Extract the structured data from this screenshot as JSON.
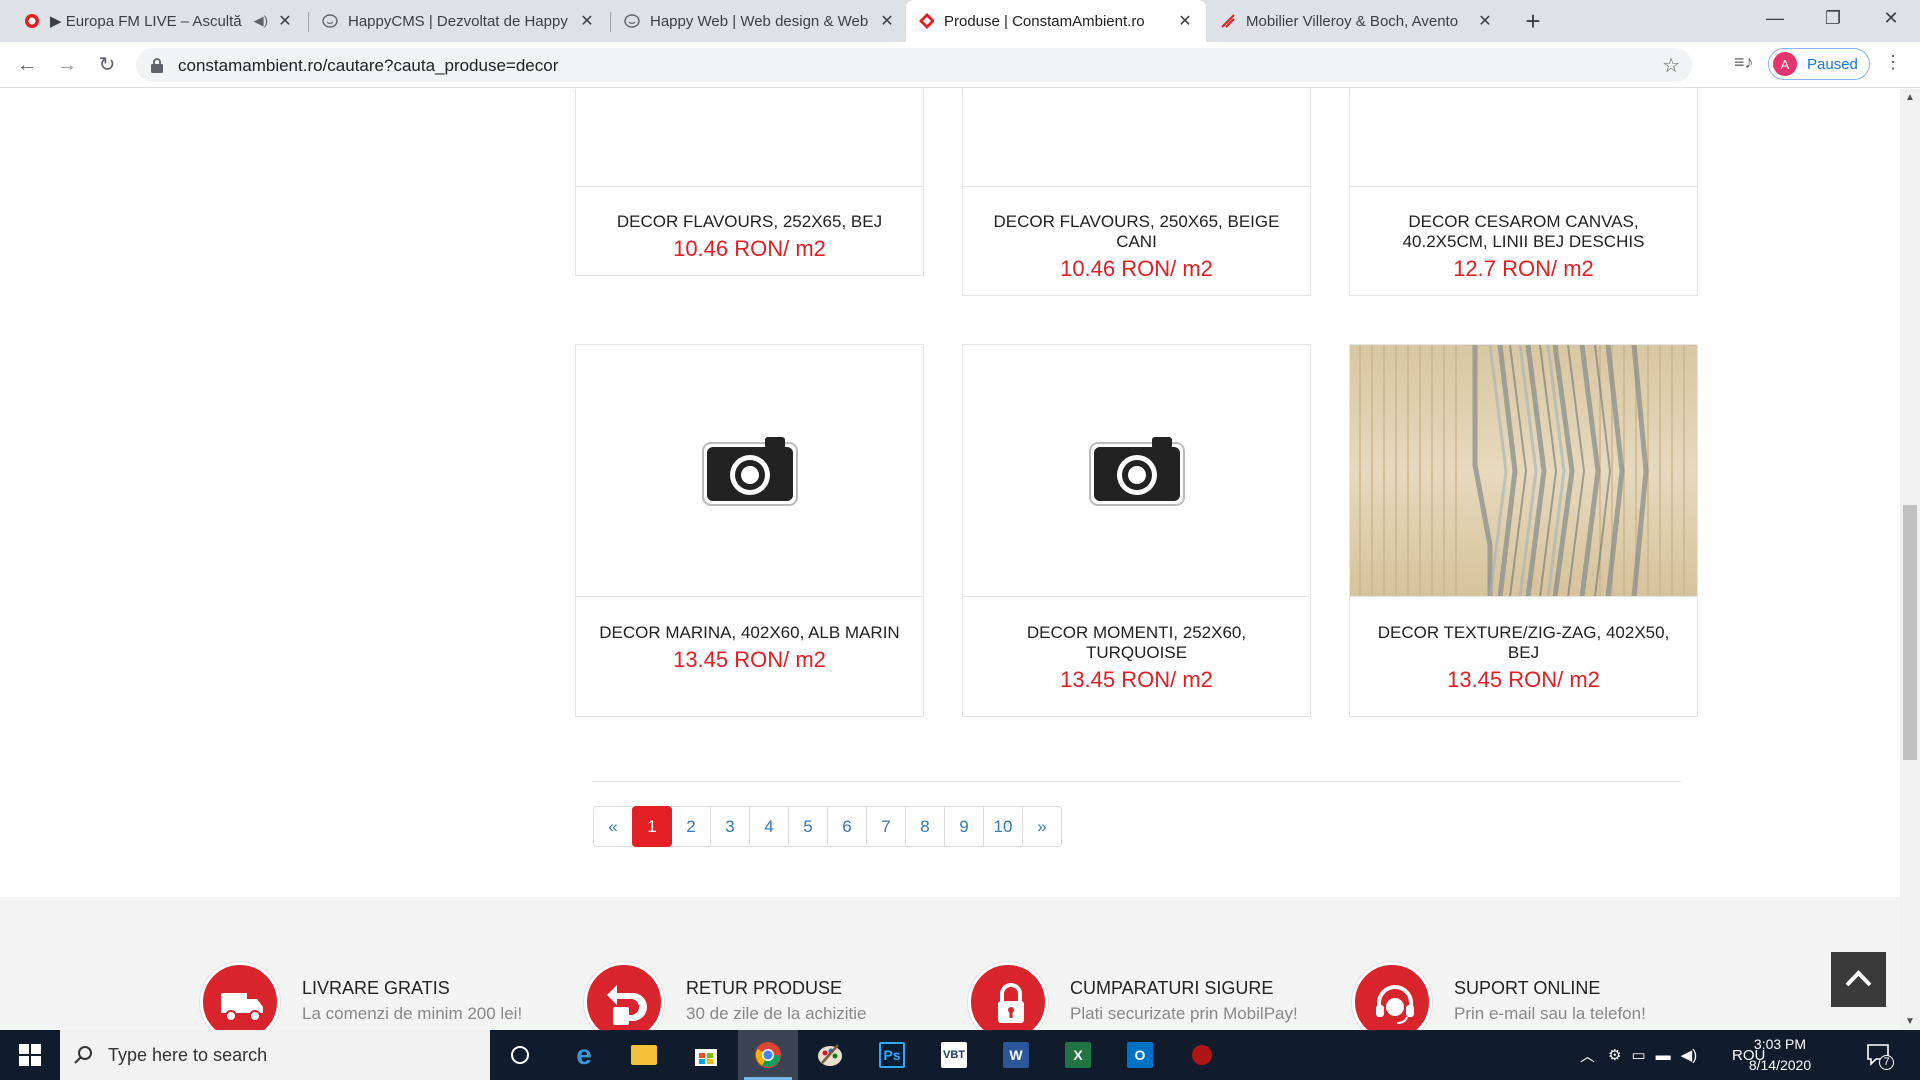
{
  "browser": {
    "tabs": [
      {
        "title": "▶ Europa FM LIVE – Ascultă",
        "favicon": "europafm-icon",
        "audio": true
      },
      {
        "title": "HappyCMS | Dezvoltat de Happy",
        "favicon": "happy-icon"
      },
      {
        "title": "Happy Web | Web design & Web",
        "favicon": "happy-icon"
      },
      {
        "title": "Produse | ConstamAmbient.ro",
        "favicon": "constam-icon",
        "active": true
      },
      {
        "title": "Mobilier Villeroy & Boch, Avento",
        "favicon": "villeroy-icon"
      }
    ],
    "url": "constamambient.ro/cautare?cauta_produse=decor",
    "profile_initial": "A",
    "profile_status": "Paused"
  },
  "products": [
    {
      "name": "DECOR FLAVOURS, 252X65, BEJ",
      "price": "10.46 RON/ m2",
      "image": "camera-placeholder"
    },
    {
      "name": "DECOR FLAVOURS, 250X65, BEIGE CANI",
      "price": "10.46 RON/ m2",
      "image": "camera-placeholder"
    },
    {
      "name": "DECOR CESAROM CANVAS, 40.2X5CM, LINII BEJ DESCHIS",
      "price": "12.7 RON/ m2",
      "image": "camera-placeholder"
    },
    {
      "name": "DECOR MARINA, 402X60, ALB MARIN",
      "price": "13.45 RON/ m2",
      "image": "camera-placeholder"
    },
    {
      "name": "DECOR MOMENTI, 252X60, TURQUOISE",
      "price": "13.45 RON/ m2",
      "image": "camera-placeholder"
    },
    {
      "name": "DECOR TEXTURE/ZIG-ZAG, 402X50, BEJ",
      "price": "13.45 RON/ m2",
      "image": "zigzag-tile"
    }
  ],
  "pagination": {
    "prev": "«",
    "pages": [
      "1",
      "2",
      "3",
      "4",
      "5",
      "6",
      "7",
      "8",
      "9",
      "10"
    ],
    "current": "1",
    "next": "»"
  },
  "features": [
    {
      "title": "LIVRARE GRATIS",
      "subtitle": "La comenzi de minim 200 lei!",
      "icon": "truck-icon"
    },
    {
      "title": "RETUR PRODUSE",
      "subtitle": "30 de zile de la achizitie",
      "icon": "return-icon"
    },
    {
      "title": "CUMPARATURI SIGURE",
      "subtitle": "Plati securizate prin MobilPay!",
      "icon": "padlock-icon"
    },
    {
      "title": "SUPORT ONLINE",
      "subtitle": "Prin e-mail sau la telefon!",
      "icon": "headset-icon"
    }
  ],
  "colors": {
    "accent": "#e31e24",
    "link": "#337ab7"
  },
  "taskbar": {
    "search_placeholder": "Type here to search",
    "language": "ROU",
    "time": "3:03 PM",
    "date": "8/14/2020",
    "notification_count": "7",
    "apps": [
      "task-view",
      "edge",
      "file-explorer",
      "store",
      "chrome",
      "paint",
      "photoshop",
      "vlc",
      "word",
      "excel",
      "outlook",
      "unknown-app"
    ]
  }
}
